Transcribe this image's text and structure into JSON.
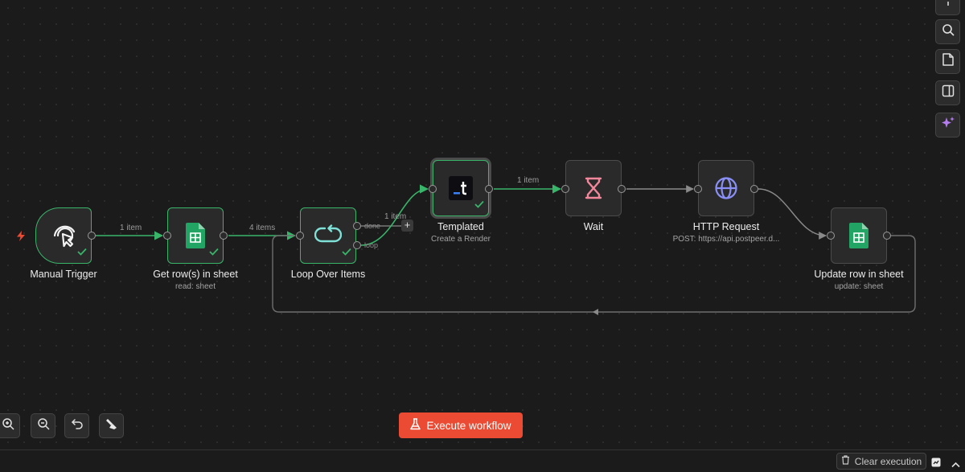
{
  "canvas": {
    "nodes": [
      {
        "id": "manual-trigger",
        "label": "Manual Trigger",
        "subtitle": "",
        "icon": "cursor-click-icon",
        "status": "success"
      },
      {
        "id": "get-rows",
        "label": "Get row(s) in sheet",
        "subtitle": "read: sheet",
        "icon": "google-sheets-icon",
        "status": "success"
      },
      {
        "id": "loop",
        "label": "Loop Over Items",
        "subtitle": "",
        "icon": "loop-icon",
        "status": "success"
      },
      {
        "id": "templated",
        "label": "Templated",
        "subtitle": "Create a Render",
        "icon": "templated-logo-icon",
        "status": "success"
      },
      {
        "id": "wait",
        "label": "Wait",
        "subtitle": "",
        "icon": "hourglass-icon",
        "status": "idle"
      },
      {
        "id": "http",
        "label": "HTTP Request",
        "subtitle": "POST: https://api.postpeer.d...",
        "icon": "globe-icon",
        "status": "idle"
      },
      {
        "id": "update-row",
        "label": "Update row in sheet",
        "subtitle": "update: sheet",
        "icon": "google-sheets-icon",
        "status": "idle"
      }
    ],
    "edges": [
      {
        "from": "manual-trigger",
        "to": "get-rows",
        "label": "1 item",
        "status": "success"
      },
      {
        "from": "get-rows",
        "to": "loop",
        "label": "4 items",
        "status": "success"
      },
      {
        "from": "loop",
        "to": "templated",
        "label": "1 item",
        "output": "loop",
        "status": "success"
      },
      {
        "from": "templated",
        "to": "wait",
        "label": "1 item",
        "status": "success"
      },
      {
        "from": "wait",
        "to": "http",
        "label": "",
        "status": "idle"
      },
      {
        "from": "http",
        "to": "update-row",
        "label": "",
        "status": "idle"
      },
      {
        "from": "update-row",
        "to": "loop",
        "label": "",
        "status": "idle"
      }
    ],
    "loop_outputs": {
      "done": "done",
      "loop": "loop"
    },
    "plus_symbol": "+"
  },
  "toolbar_right": [
    {
      "name": "zoom-to-fit",
      "icon": "expand-icon"
    },
    {
      "name": "search",
      "icon": "search-icon"
    },
    {
      "name": "sticky-note",
      "icon": "sticky-note-icon"
    },
    {
      "name": "toggle-panel",
      "icon": "panel-icon"
    },
    {
      "name": "ai-assistant",
      "icon": "sparkles-icon"
    }
  ],
  "toolbar_bottom": [
    {
      "name": "zoom-in",
      "icon": "zoom-in-icon"
    },
    {
      "name": "zoom-out",
      "icon": "zoom-out-icon"
    },
    {
      "name": "undo",
      "icon": "undo-icon"
    },
    {
      "name": "tidy-up",
      "icon": "broom-icon"
    }
  ],
  "execute_button": {
    "label": "Execute workflow",
    "icon": "flask-icon"
  },
  "bottom_bar": {
    "clear_execution": "Clear execution"
  },
  "colors": {
    "success": "#39b56a",
    "accent": "#eb4b33",
    "sheets": "#21a464",
    "wait": "#f2879c",
    "http": "#8a8ff5",
    "ai": "#b57cf0"
  }
}
